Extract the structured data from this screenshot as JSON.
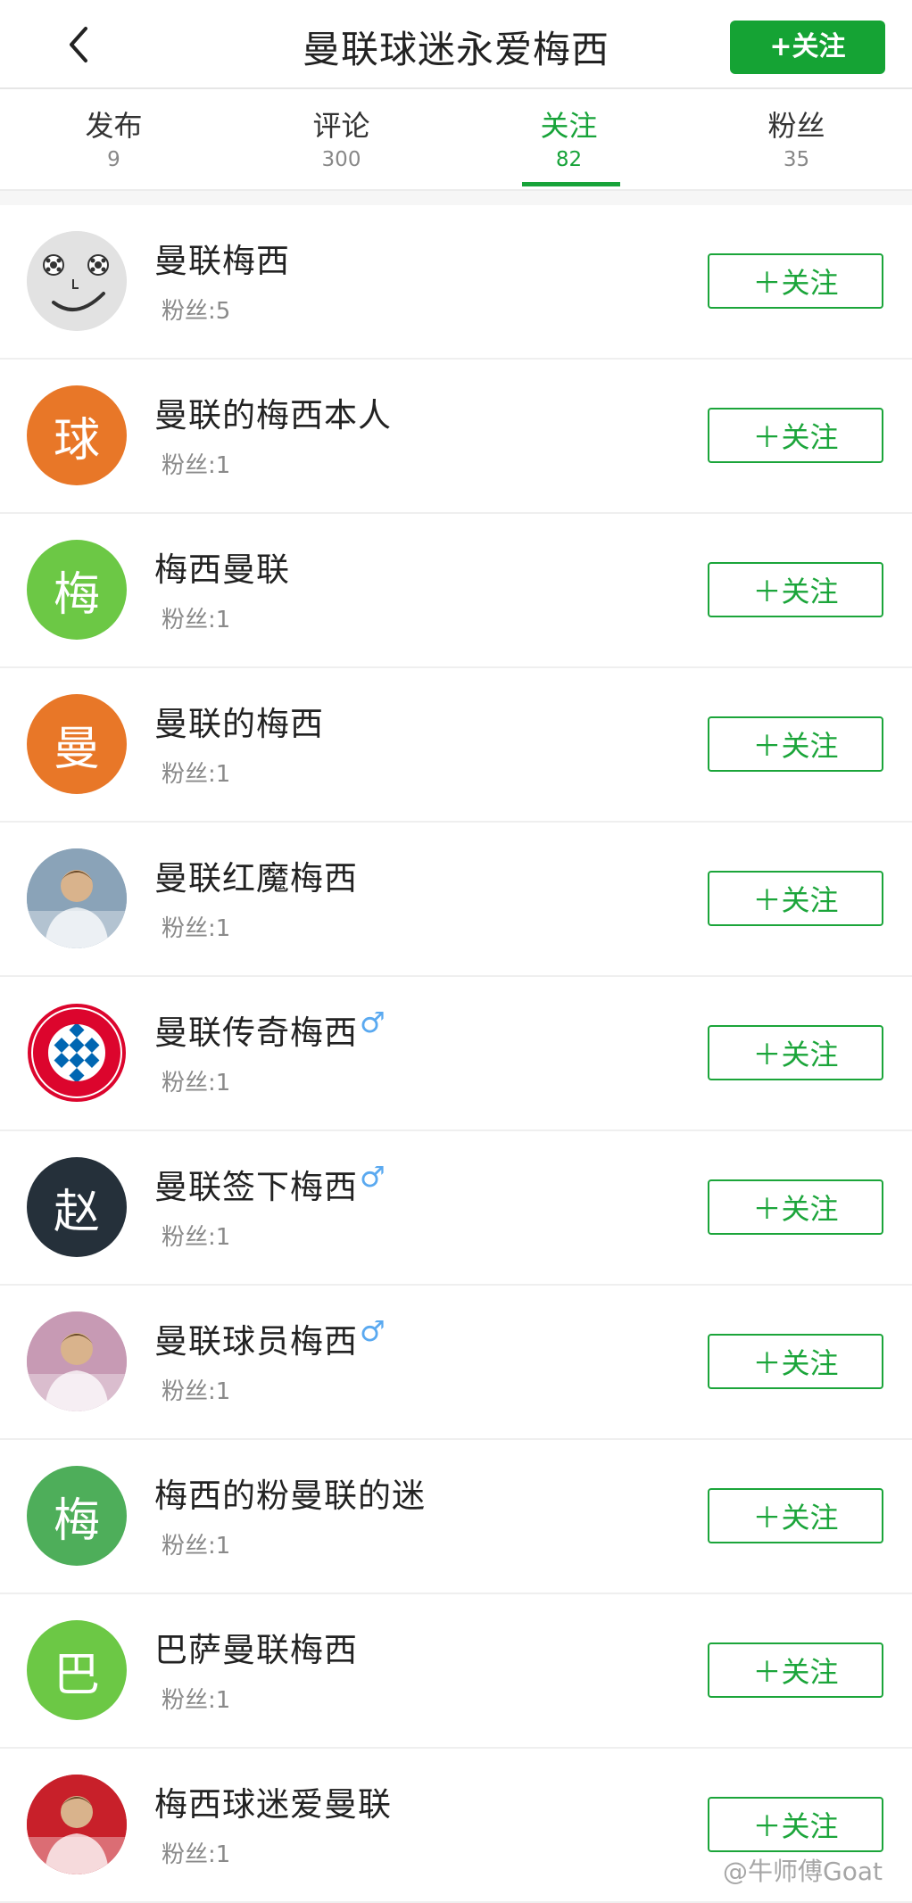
{
  "header": {
    "title": "曼联球迷永爱梅西",
    "follow_label": "+关注",
    "accent": "#15a334"
  },
  "tabs": [
    {
      "label": "发布",
      "count": "9"
    },
    {
      "label": "评论",
      "count": "300"
    },
    {
      "label": "关注",
      "count": "82"
    },
    {
      "label": "粉丝",
      "count": "35"
    }
  ],
  "active_tab": "关注",
  "list": {
    "follow_label": "＋关注",
    "items": [
      {
        "name": "曼联梅西",
        "fans": "粉丝:5",
        "avatar_icon": "smiley-face-icon",
        "avatar_char": "",
        "avatar_color": "#e2e2e2",
        "gender": ""
      },
      {
        "name": "曼联的梅西本人",
        "fans": "粉丝:1",
        "avatar_icon": "",
        "avatar_char": "球",
        "avatar_color": "#e87728",
        "gender": ""
      },
      {
        "name": "梅西曼联",
        "fans": "粉丝:1",
        "avatar_icon": "",
        "avatar_char": "梅",
        "avatar_color": "#6cc845",
        "gender": ""
      },
      {
        "name": "曼联的梅西",
        "fans": "粉丝:1",
        "avatar_icon": "",
        "avatar_char": "曼",
        "avatar_color": "#e87728",
        "gender": ""
      },
      {
        "name": "曼联红魔梅西",
        "fans": "粉丝:1",
        "avatar_icon": "player-photo-icon",
        "avatar_char": "",
        "avatar_color": "#8aa3b8",
        "gender": ""
      },
      {
        "name": "曼联传奇梅西",
        "fans": "粉丝:1",
        "avatar_icon": "bayern-logo-icon",
        "avatar_char": "",
        "avatar_color": "#ffffff",
        "gender": "♂"
      },
      {
        "name": "曼联签下梅西",
        "fans": "粉丝:1",
        "avatar_icon": "",
        "avatar_char": "赵",
        "avatar_color": "#25303a",
        "gender": "♂"
      },
      {
        "name": "曼联球员梅西",
        "fans": "粉丝:1",
        "avatar_icon": "player-photo-icon",
        "avatar_char": "",
        "avatar_color": "#c79ab4",
        "gender": "♂"
      },
      {
        "name": "梅西的粉曼联的迷",
        "fans": "粉丝:1",
        "avatar_icon": "",
        "avatar_char": "梅",
        "avatar_color": "#4eae5a",
        "gender": ""
      },
      {
        "name": "巴萨曼联梅西",
        "fans": "粉丝:1",
        "avatar_icon": "",
        "avatar_char": "巴",
        "avatar_color": "#6cc845",
        "gender": ""
      },
      {
        "name": "梅西球迷爱曼联",
        "fans": "粉丝:1",
        "avatar_icon": "player-photo-icon",
        "avatar_char": "",
        "avatar_color": "#c8202a",
        "gender": ""
      }
    ]
  },
  "watermark": "@牛师傅Goat"
}
